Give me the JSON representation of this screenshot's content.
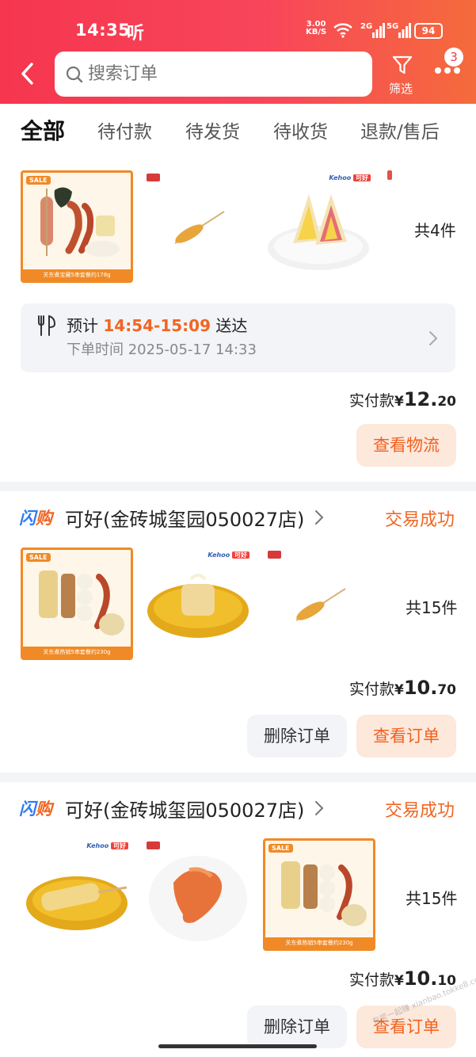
{
  "status_bar": {
    "time": "14:35",
    "ting_icon": "听",
    "net_speed_value": "3.00",
    "net_speed_unit": "KB/S",
    "signal_1": "2G",
    "signal_2": "5G",
    "battery": "94"
  },
  "header": {
    "search_placeholder": "搜索订单",
    "filter_label": "筛选",
    "more_badge": "3"
  },
  "tabs": [
    {
      "label": "全部",
      "active": true
    },
    {
      "label": "待付款"
    },
    {
      "label": "待发货"
    },
    {
      "label": "待收货"
    },
    {
      "label": "退款/售后"
    }
  ],
  "orders": [
    {
      "count": "共4件",
      "thumb_captions": [
        "关东煮宝藏5串套餐约178g"
      ],
      "sale_tag": "SALE",
      "brand_tag": [
        "Kehoo",
        "可好"
      ],
      "eta_prefix": "预计",
      "eta_time": "14:54-15:09",
      "eta_suffix": "送达",
      "order_time": "下单时间 2025-05-17 14:33",
      "paid_label": "实付款",
      "currency": "¥",
      "amount_int": "12.",
      "amount_dec": "20",
      "buttons": [
        "查看物流"
      ]
    },
    {
      "shangou": [
        "闪",
        "购"
      ],
      "shop_name": "可好(金砖城玺园050027店)",
      "status": "交易成功",
      "count": "共15件",
      "thumb_captions": [
        "关东煮热销5串套餐约230g"
      ],
      "sale_tag": "SALE",
      "brand_tag": [
        "Kehoo",
        "可好"
      ],
      "paid_label": "实付款",
      "currency": "¥",
      "amount_int": "10.",
      "amount_dec": "70",
      "buttons": [
        "删除订单",
        "查看订单"
      ]
    },
    {
      "shangou": [
        "闪",
        "购"
      ],
      "shop_name": "可好(金砖城玺园050027店)",
      "status": "交易成功",
      "count": "共15件",
      "thumb_captions": [
        "关东煮热销5串套餐约230g"
      ],
      "sale_tag": "SALE",
      "brand_tag": [
        "Kehoo",
        "可好"
      ],
      "paid_label": "实付款",
      "currency": "¥",
      "amount_int": "10.",
      "amount_dec": "10",
      "buttons": [
        "删除订单",
        "查看订单"
      ]
    }
  ],
  "watermark": "有奖一起赚 xianbao.tokke8.com",
  "colors": {
    "header_start": "#f5364e",
    "header_end": "#f56b3c",
    "accent_orange": "#f26522",
    "primary_btn_bg": "#fde8dc"
  }
}
